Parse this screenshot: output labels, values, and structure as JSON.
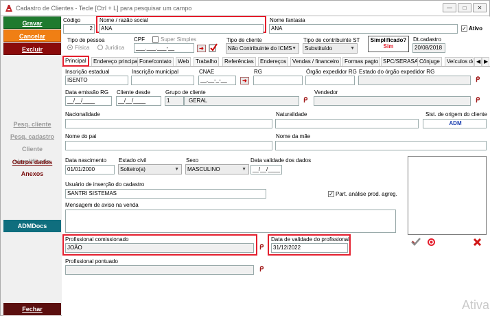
{
  "window": {
    "title": "Cadastro de Clientes - Tecle [Ctrl + L] para pesquisar um campo",
    "min": "—",
    "max": "□",
    "close": "✕"
  },
  "sidebar": {
    "gravar": "Gravar",
    "cancelar": "Cancelar",
    "excluir": "Excluir",
    "pesq_cliente": "Pesq. cliente",
    "pesq_cadastro": "Pesq. cadastro",
    "cliente_simplificado": "Cliente simplificado",
    "outros_dados": "Outros dados",
    "anexos": "Anexos",
    "admdocs": "ADMDocs",
    "fechar": "Fechar"
  },
  "header": {
    "codigo_label": "Código",
    "codigo_value": "2",
    "nome_label": "Nome / razão social",
    "nome_value": "ANA",
    "fantasia_label": "Nome fantasia",
    "fantasia_value": "ANA",
    "ativo_label": "Ativo",
    "ativo_check": "✓",
    "tipo_pessoa_label": "Tipo de pessoa",
    "fisica": "Física",
    "juridica": "Jurídica",
    "cpf_label": "CPF",
    "cpf_value": "___.___.___-__",
    "super_simples": "Super Simples",
    "tipo_cliente_label": "Tipo de cliente",
    "tipo_cliente_value": "Não Contribuinte do ICMS",
    "tipo_contrib_label": "Tipo de contribuinte ST",
    "tipo_contrib_value": "Substituído",
    "simplificado_label": "Simplificado?",
    "simplificado_value": "Sim",
    "dt_cadastro_label": "Dt.cadastro",
    "dt_cadastro_value": "20/08/2018"
  },
  "tabs": [
    "Principal",
    "Endereço principal",
    "Fone/contato",
    "Web",
    "Trabalho",
    "Referências",
    "Endereços",
    "Vendas / financeiro",
    "Formas pagto",
    "SPC/SERASA",
    "Cônjuge",
    "Veículos de"
  ],
  "tab_arrows": {
    "left": "◀",
    "right": "▶"
  },
  "form": {
    "insc_estadual_label": "Inscrição estadual",
    "insc_estadual_value": "ISENTO",
    "insc_municipal_label": "Inscrição municipal",
    "insc_municipal_value": "",
    "cnae_label": "CNAE",
    "cnae_value": "__.__-_-__",
    "rg_label": "RG",
    "rg_value": "",
    "orgao_label": "Órgão expedidor RG",
    "orgao_value": "",
    "estado_orgao_label": "Estado do órgão expedidor RG",
    "data_emissao_label": "Data emissão RG",
    "data_emissao_value": "__/__/____",
    "cliente_desde_label": "Cliente desde",
    "cliente_desde_value": "__/__/____",
    "grupo_label": "Grupo de cliente",
    "grupo_code": "1",
    "grupo_name": "GERAL",
    "vendedor_label": "Vendedor",
    "nacionalidade_label": "Nacionalidade",
    "naturalidade_label": "Naturalidade",
    "sist_origem_label": "Sist. de origem do cliente",
    "sist_origem_value": "ADM",
    "pai_label": "Nome do pai",
    "mae_label": "Nome da mãe",
    "nascimento_label": "Data nascimento",
    "nascimento_value": "01/01/2000",
    "estado_civil_label": "Estado civil",
    "estado_civil_value": "Solteiro(a)",
    "sexo_label": "Sexo",
    "sexo_value": "MASCULINO",
    "validade_dados_label": "Data validade dos dados",
    "validade_dados_value": "__/__/____",
    "usuario_label": "Usuário de inserção do cadastro",
    "usuario_value": "SANTRI SISTEMAS",
    "part_label": "Part. análise prod. agreg.",
    "part_check": "✓",
    "mensagem_label": "Mensagem de aviso na venda",
    "prof_comissionado_label": "Profissional comissionado",
    "prof_comissionado_value": "JOÃO",
    "validade_prof_label": "Data de validade do profissional",
    "validade_prof_value": "31/12/2022",
    "prof_pontuado_label": "Profissional pontuado"
  },
  "watermark": "Ativa",
  "colors": {
    "accent_red": "#e41e2d",
    "green": "#1f7a2e",
    "orange": "#f07f14",
    "teal": "#0f6e7e"
  }
}
